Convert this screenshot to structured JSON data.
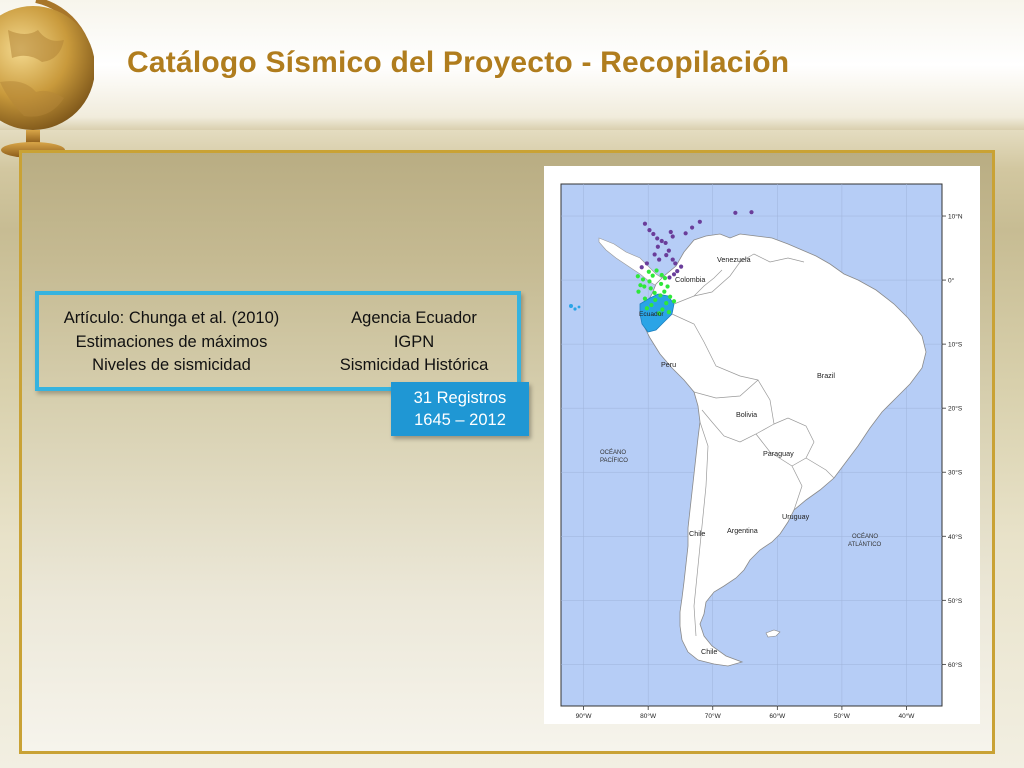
{
  "slide": {
    "title": "Catálogo Sísmico del Proyecto - Recopilación"
  },
  "info_box": {
    "left_lines": [
      "Artículo: Chunga et al. (2010)",
      "Estimaciones de máximos",
      "Niveles de sismicidad"
    ],
    "right_lines": [
      "Agencia Ecuador",
      "IGPN",
      "Sismicidad Histórica"
    ]
  },
  "badge": {
    "line1": "31 Registros",
    "line2": "1645 – 2012"
  },
  "map": {
    "colors": {
      "ocean": "#b6cdf6",
      "land": "#ffffff",
      "ecuador": "#2aa4e6",
      "events_purple": "#6a3d9a",
      "events_green": "#2ee83a"
    },
    "country_labels": [
      "Venezuela",
      "Colombia",
      "Ecuador",
      "Peru",
      "Brazil",
      "Bolivia",
      "Paraguay",
      "Chile",
      "Argentina",
      "Uruguay",
      "Chile"
    ],
    "ocean_labels": [
      {
        "line1": "OCÉANO",
        "line2": "PACÍFICO"
      },
      {
        "line1": "OCÉANO",
        "line2": "ATLÁNTICO"
      }
    ],
    "lat_ticks": [
      "10°N",
      "0°",
      "10°S",
      "20°S",
      "30°S",
      "40°S",
      "50°S",
      "60°S"
    ],
    "lon_ticks": [
      "90°W",
      "80°W",
      "70°W",
      "60°W",
      "50°W",
      "40°W"
    ],
    "events": {
      "purple": [
        [
          -80.5,
          8.8
        ],
        [
          -79.8,
          7.8
        ],
        [
          -79.2,
          7.2
        ],
        [
          -78.6,
          6.5
        ],
        [
          -77.9,
          6.1
        ],
        [
          -77.3,
          5.8
        ],
        [
          -76.5,
          7.5
        ],
        [
          -76.2,
          6.8
        ],
        [
          -76.8,
          4.6
        ],
        [
          -77.2,
          3.9
        ],
        [
          -76.2,
          3.2
        ],
        [
          -75.8,
          2.6
        ],
        [
          -74.9,
          2.1
        ],
        [
          -75.5,
          1.4
        ],
        [
          -76.0,
          0.9
        ],
        [
          -76.7,
          0.4
        ],
        [
          -74.2,
          7.3
        ],
        [
          -73.2,
          8.2
        ],
        [
          -72.0,
          9.1
        ],
        [
          -66.5,
          10.5
        ],
        [
          -64.0,
          10.6
        ],
        [
          -78.5,
          5.2
        ],
        [
          -79.0,
          4.0
        ],
        [
          -80.2,
          2.6
        ],
        [
          -81.0,
          2.0
        ],
        [
          -78.3,
          3.2
        ]
      ],
      "green": [
        [
          -80.8,
          0.1
        ],
        [
          -81.2,
          -0.8
        ],
        [
          -81.5,
          -1.8
        ],
        [
          -80.6,
          -1.0
        ],
        [
          -79.8,
          -0.2
        ],
        [
          -79.3,
          0.7
        ],
        [
          -78.7,
          1.5
        ],
        [
          -77.9,
          0.8
        ],
        [
          -77.4,
          0.3
        ],
        [
          -77.0,
          -1.0
        ],
        [
          -77.5,
          -1.8
        ],
        [
          -78.1,
          -2.4
        ],
        [
          -78.9,
          -3.1
        ],
        [
          -79.5,
          -3.9
        ],
        [
          -80.2,
          -4.4
        ],
        [
          -77.2,
          -3.6
        ],
        [
          -76.6,
          -2.6
        ],
        [
          -76.8,
          -5.0
        ],
        [
          -78.3,
          -5.2
        ],
        [
          -79.0,
          -2.0
        ],
        [
          -79.6,
          -1.3
        ],
        [
          -78.0,
          -0.6
        ],
        [
          -81.6,
          0.6
        ],
        [
          -80.5,
          -2.9
        ],
        [
          -77.8,
          -4.6
        ],
        [
          -76.0,
          -3.3
        ],
        [
          -79.9,
          1.3
        ]
      ]
    }
  }
}
